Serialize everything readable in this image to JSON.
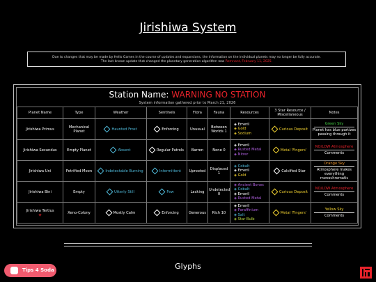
{
  "page": {
    "title": "Jirishiwa System",
    "notice_line1": "Due to changes that may be made by Hello Games in the course of updates and expansions, the information on the individual planets may no longer be fully accurate.",
    "notice_line2_prefix": "The last known update that changed the planetary generation algorithm was ",
    "notice_line2_link": "Remnant, February 11, 2025.",
    "station_label": "Station Name:",
    "station_value": "WARNING NO STATION",
    "gathered": "System information gathered prior to March 21, 2026",
    "glyphs": "Glyphs"
  },
  "table": {
    "headers": [
      "Planet Name",
      "Type",
      "Weather",
      "Sentinels",
      "Flora",
      "Fauna",
      "Resources",
      "3 Star Resource / Miscellaneous",
      "Notes"
    ],
    "rows": [
      {
        "name": "Jirishiwa Primus",
        "type": "Mechanical Planet",
        "weather": "Haunted Frost",
        "sentinels": "Enforcing",
        "flora": "Unusual",
        "fauna": "Between Worlds 1",
        "resources": [
          "Emeril",
          "Gold",
          "Sodium"
        ],
        "misc": "Curious Deposit",
        "notes_top": "Green Sky",
        "notes_main": "Planet has blue partizes passing through it"
      },
      {
        "name": "Jirishiwa Secundus",
        "type": "Empty Planet",
        "weather": "Absent",
        "sentinels": "Regular Patrols",
        "flora": "Barren",
        "fauna": "None 0",
        "resources": [
          "Emeril",
          "Rusted Metal",
          "Nitrer"
        ],
        "misc": "Metal 'Fingers'",
        "notes_top": "NO/LOW Atmosphere",
        "notes_main": "Comments"
      },
      {
        "name": "Jirishiwa Uni",
        "type": "Petrified Moon",
        "weather": "Indetectable Burning",
        "sentinels": "Intermittent",
        "flora": "Uprooted",
        "fauna": "Displaced 1",
        "resources": [
          "Cobalt",
          "Emeril",
          "Gold"
        ],
        "misc": "Calcified Star",
        "notes_top": "Orange Sky",
        "notes_main": "Atmosphere makes everything monochromatic"
      },
      {
        "name": "Jirishiwa Bini",
        "type": "Empty",
        "weather": "Utterly Still",
        "sentinels": "Few",
        "flora": "Lacking",
        "fauna": "Undetected 0",
        "resources": [
          "Ancient Bones",
          "Cobalt",
          "Emeril",
          "Rusted Metal"
        ],
        "misc": "Curious Deposit",
        "notes_top": "NO/LOW Atmosphere",
        "notes_main": "Comments"
      },
      {
        "name": "Jirishiwa Tertius",
        "type": "Xeno-Colony",
        "weather": "Mostly Calm",
        "sentinels": "Enforcing",
        "flora": "Generous",
        "fauna": "Rich 10",
        "resources": [
          "Emeril",
          "Paraffinium",
          "Salt",
          "Star Bulb"
        ],
        "misc": "Metal 'Fingers'",
        "notes_top": "Yellow Sky",
        "notes_main": "Comments"
      }
    ]
  },
  "tips_button": "Tips 4 Soda",
  "colors": {
    "warning": "#e8232b",
    "tips": "#f05a6e"
  }
}
